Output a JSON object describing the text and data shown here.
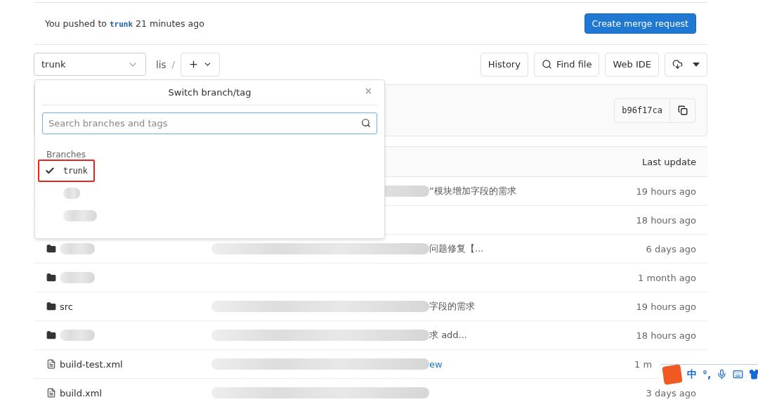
{
  "notice": {
    "before": "You pushed to",
    "branch": "trunk",
    "after": "21 minutes ago",
    "button": "Create merge request"
  },
  "toolbar": {
    "branch": "trunk",
    "path": "lis",
    "separator": "/",
    "buttons": [
      "History",
      "Find file",
      "Web IDE"
    ]
  },
  "commit_box": {
    "sha": "b96f17ca"
  },
  "table": {
    "header": "Last update",
    "rows": [
      {
        "commit": "”模块增加字段的需求",
        "commit_redacted": true,
        "commit_link": false,
        "updated": "19 hours ago"
      },
      {
        "updated": "18 hours ago"
      },
      {
        "kind": "folder",
        "name_redacted": true,
        "commit": "问题修复【...",
        "commit_redacted": true,
        "commit_link": false,
        "updated": "6 days ago"
      },
      {
        "kind": "folder",
        "name_redacted": true,
        "updated": "1 month ago"
      },
      {
        "kind": "folder",
        "name": "src",
        "commit": "字段的需求",
        "commit_redacted": true,
        "commit_link": false,
        "updated": "19 hours ago"
      },
      {
        "kind": "folder",
        "name_redacted": true,
        "commit": "求 add...",
        "commit_redacted": true,
        "commit_link": false,
        "updated": "18 hours ago"
      },
      {
        "kind": "file",
        "name": "build-test.xml",
        "commit": "ew",
        "commit_redacted": true,
        "commit_link": true,
        "updated": "1 m",
        "covered": true
      },
      {
        "kind": "file",
        "name": "build.xml",
        "commit_redacted": true,
        "updated": "3 days ago"
      }
    ]
  },
  "dropdown": {
    "title": "Switch branch/tag",
    "close": "×",
    "search_placeholder": "Search branches and tags",
    "section": "Branches",
    "items": [
      {
        "kind": "branch",
        "name": "trunk",
        "selected": true,
        "highlighted": true
      },
      {
        "kind": "redacted",
        "selected": false,
        "highlighted": false
      },
      {
        "kind": "redacted",
        "selected": false,
        "highlighted": false
      }
    ]
  },
  "ime_toolbar": {
    "mode": "中",
    "punctuation": "°,"
  }
}
